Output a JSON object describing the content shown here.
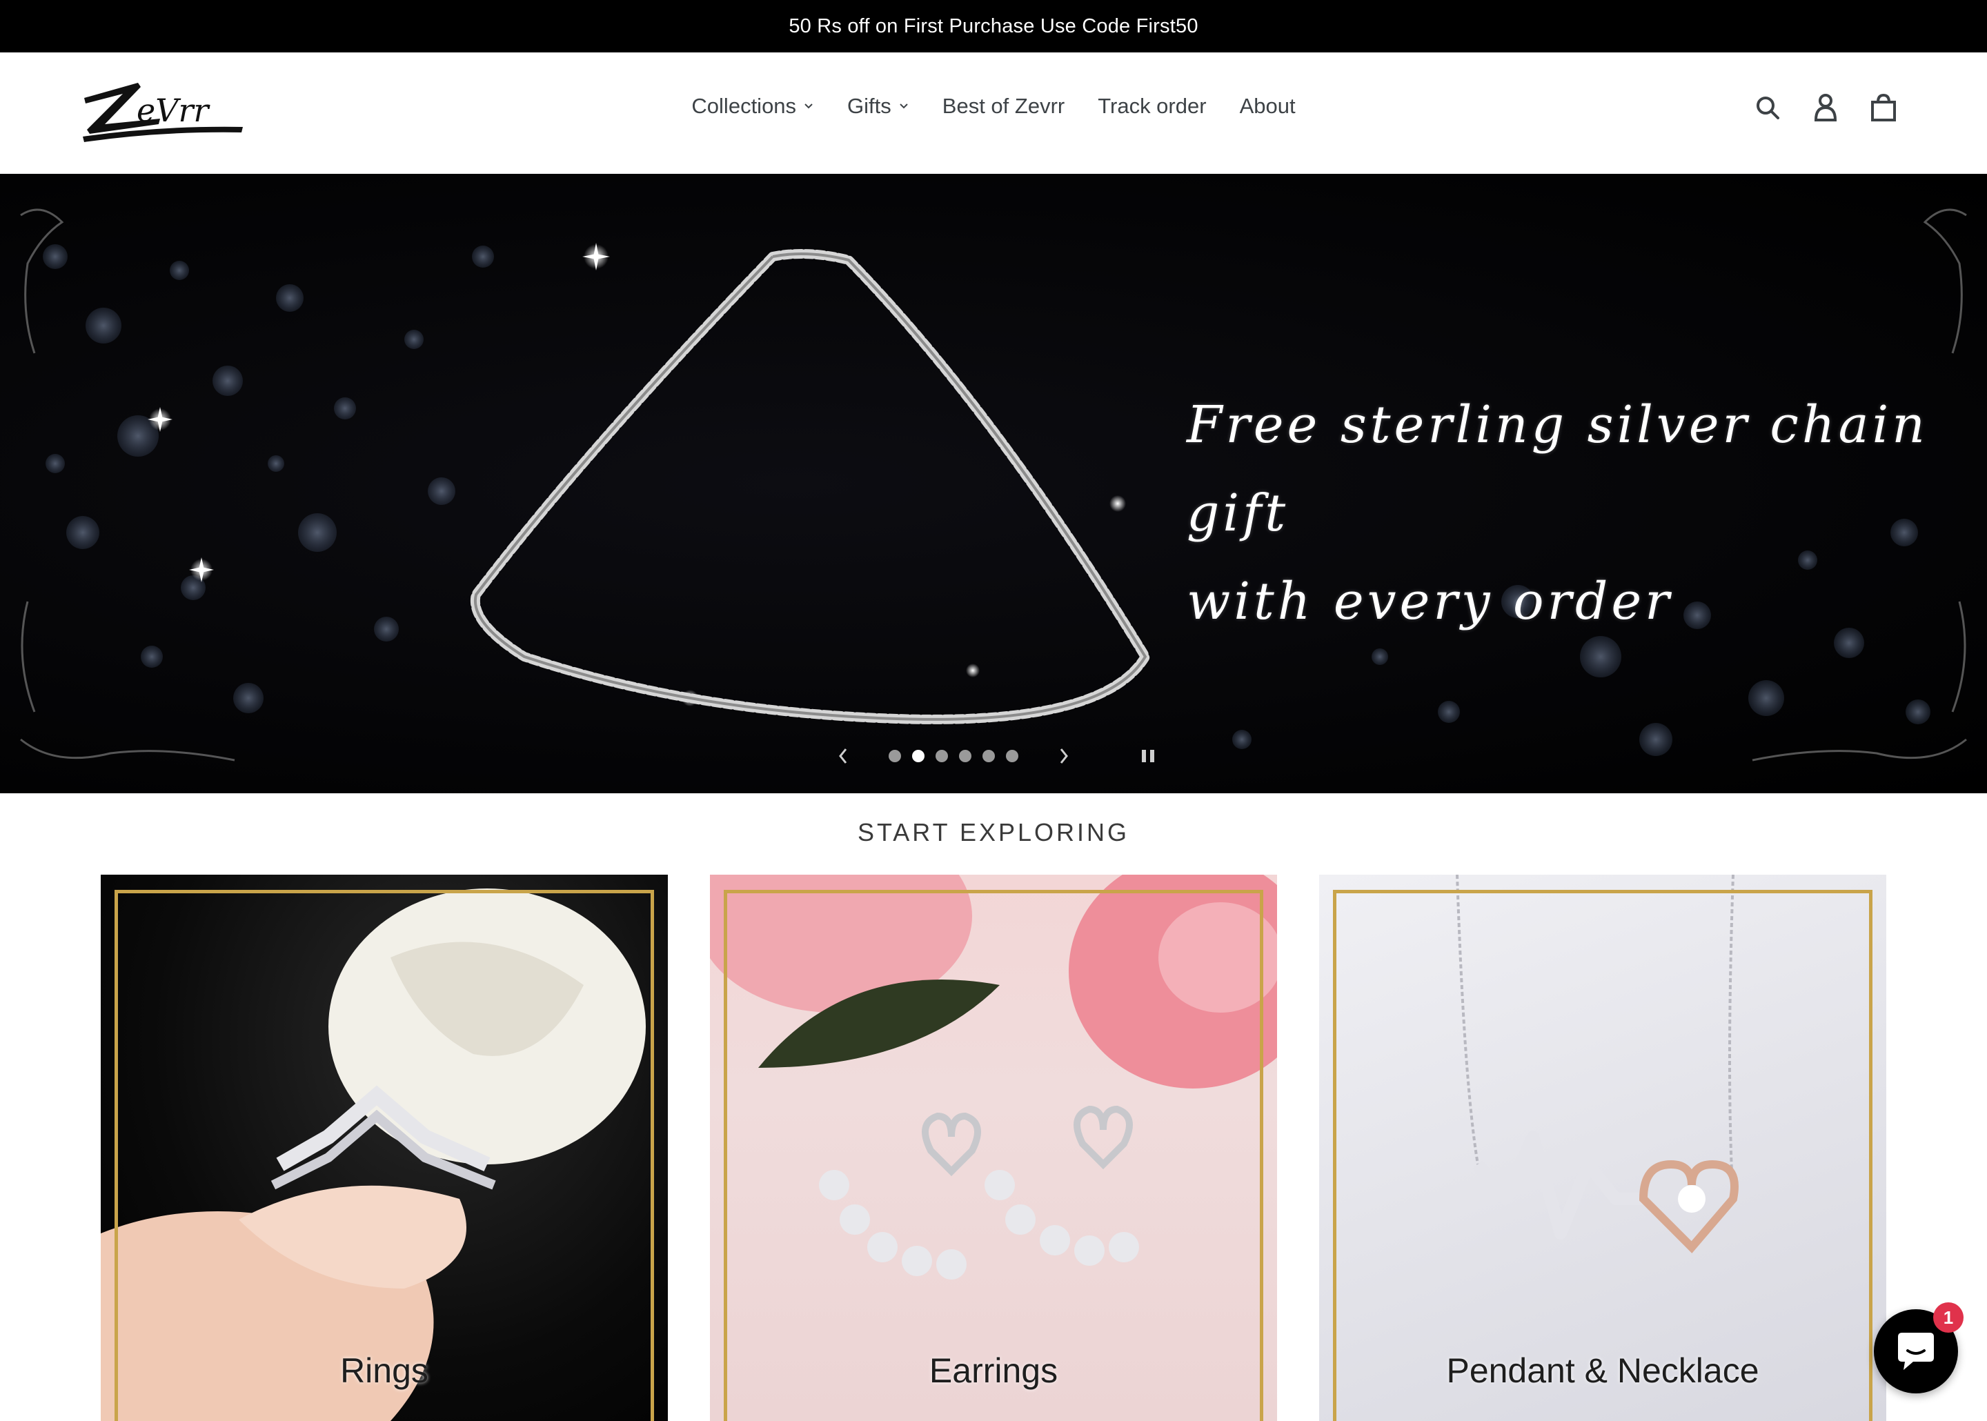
{
  "announcement": {
    "text": "50 Rs off on First Purchase Use Code First50"
  },
  "header": {
    "logo_text": "ZeVrr",
    "nav": [
      {
        "label": "Collections",
        "has_dropdown": true
      },
      {
        "label": "Gifts",
        "has_dropdown": true
      },
      {
        "label": "Best of Zevrr",
        "has_dropdown": false
      },
      {
        "label": "Track order",
        "has_dropdown": false
      },
      {
        "label": "About",
        "has_dropdown": false
      }
    ],
    "icons": [
      "search-icon",
      "account-icon",
      "cart-icon"
    ]
  },
  "hero": {
    "line1": "Free sterling silver chain gift",
    "line2": "with every order",
    "slide_count": 6,
    "active_slide": 2
  },
  "explore": {
    "title": "START EXPLORING",
    "cards": [
      {
        "label": "Rings"
      },
      {
        "label": "Earrings"
      },
      {
        "label": "Pendant & Necklace"
      }
    ]
  },
  "chat": {
    "badge_count": "1"
  },
  "colors": {
    "gold_frame": "#c9a44a",
    "badge": "#e0324b",
    "announcement_bg": "#000000"
  }
}
